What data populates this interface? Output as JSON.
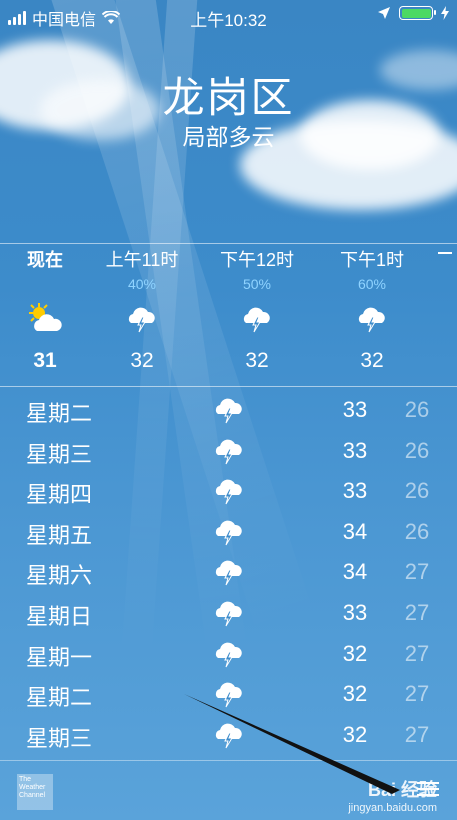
{
  "status_bar": {
    "carrier": "中国电信",
    "time": "上午10:32",
    "battery_color": "#4cd964"
  },
  "location": {
    "city": "龙岗区",
    "condition": "局部多云"
  },
  "hourly": [
    {
      "label": "现在",
      "precip": "",
      "icon": "partly-sunny-icon",
      "temp": "31"
    },
    {
      "label": "上午11时",
      "precip": "40%",
      "icon": "thunderstorm-icon",
      "temp": "32"
    },
    {
      "label": "下午12时",
      "precip": "50%",
      "icon": "thunderstorm-icon",
      "temp": "32"
    },
    {
      "label": "下午1时",
      "precip": "60%",
      "icon": "thunderstorm-icon",
      "temp": "32"
    }
  ],
  "daily": [
    {
      "day": "星期二",
      "icon": "thunderstorm-icon",
      "high": "33",
      "low": "26"
    },
    {
      "day": "星期三",
      "icon": "thunderstorm-icon",
      "high": "33",
      "low": "26"
    },
    {
      "day": "星期四",
      "icon": "thunderstorm-icon",
      "high": "33",
      "low": "26"
    },
    {
      "day": "星期五",
      "icon": "thunderstorm-icon",
      "high": "34",
      "low": "26"
    },
    {
      "day": "星期六",
      "icon": "thunderstorm-icon",
      "high": "34",
      "low": "27"
    },
    {
      "day": "星期日",
      "icon": "thunderstorm-icon",
      "high": "33",
      "low": "27"
    },
    {
      "day": "星期一",
      "icon": "thunderstorm-icon",
      "high": "32",
      "low": "27"
    },
    {
      "day": "星期二",
      "icon": "thunderstorm-icon",
      "high": "32",
      "low": "27"
    },
    {
      "day": "星期三",
      "icon": "thunderstorm-icon",
      "high": "32",
      "low": "27"
    }
  ],
  "footer": {
    "provider": "The Weather Channel",
    "watermark_main": "Bai 经验",
    "watermark_sub": "jingyan.baidu.com"
  }
}
